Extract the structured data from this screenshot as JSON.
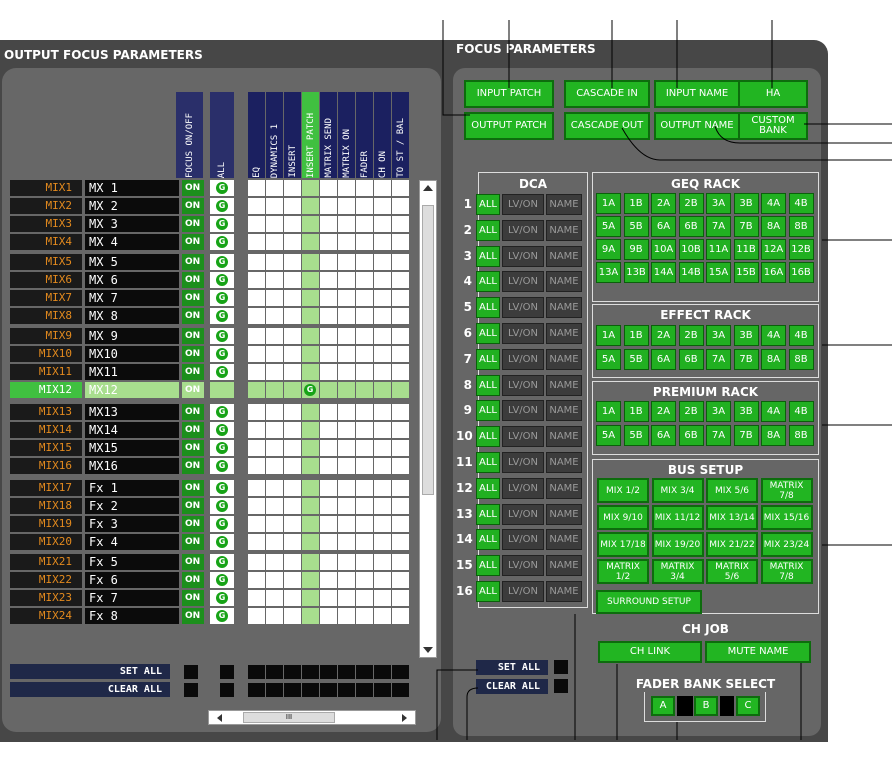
{
  "titles": {
    "output_focus": "OUTPUT FOCUS PARAMETERS",
    "focus": "FOCUS PARAMETERS"
  },
  "columns": [
    "FOCUS ON/OFF",
    "ALL",
    "EQ",
    "DYNAMICS 1",
    "INSERT",
    "INSERT PATCH",
    "MATRIX SEND",
    "MATRIX ON",
    "FADER",
    "CH ON",
    "TO ST / BAL"
  ],
  "rows": [
    {
      "mix": "MIX1",
      "name": "MX 1"
    },
    {
      "mix": "MIX2",
      "name": "MX 2"
    },
    {
      "mix": "MIX3",
      "name": "MX 3"
    },
    {
      "mix": "MIX4",
      "name": "MX 4"
    },
    {
      "mix": "MIX5",
      "name": "MX 5"
    },
    {
      "mix": "MIX6",
      "name": "MX 6"
    },
    {
      "mix": "MIX7",
      "name": "MX 7"
    },
    {
      "mix": "MIX8",
      "name": "MX 8"
    },
    {
      "mix": "MIX9",
      "name": "MX 9"
    },
    {
      "mix": "MIX10",
      "name": "MX10"
    },
    {
      "mix": "MIX11",
      "name": "MX11"
    },
    {
      "mix": "MIX12",
      "name": "MX12"
    },
    {
      "mix": "MIX13",
      "name": "MX13"
    },
    {
      "mix": "MIX14",
      "name": "MX14"
    },
    {
      "mix": "MIX15",
      "name": "MX15"
    },
    {
      "mix": "MIX16",
      "name": "MX16"
    },
    {
      "mix": "MIX17",
      "name": "Fx 1"
    },
    {
      "mix": "MIX18",
      "name": "Fx 2"
    },
    {
      "mix": "MIX19",
      "name": "Fx 3"
    },
    {
      "mix": "MIX20",
      "name": "Fx 4"
    },
    {
      "mix": "MIX21",
      "name": "Fx 5"
    },
    {
      "mix": "MIX22",
      "name": "Fx 6"
    },
    {
      "mix": "MIX23",
      "name": "Fx 7"
    },
    {
      "mix": "MIX24",
      "name": "Fx 8"
    }
  ],
  "on_label": "ON",
  "g_label": "G",
  "set_all": "SET ALL",
  "clear_all": "CLEAR ALL",
  "top_buttons": [
    "INPUT PATCH",
    "CASCADE IN",
    "INPUT NAME",
    "HA",
    "OUTPUT PATCH",
    "CASCADE OUT",
    "OUTPUT NAME",
    "CUSTOM BANK"
  ],
  "dca": {
    "title": "DCA",
    "numbers": [
      "1",
      "2",
      "3",
      "4",
      "5",
      "6",
      "7",
      "8",
      "9",
      "10",
      "11",
      "12",
      "13",
      "14",
      "15",
      "16"
    ],
    "all": "ALL",
    "lvon": "LV/ON",
    "name": "NAME"
  },
  "geq": {
    "title": "GEQ RACK",
    "buttons": [
      "1A",
      "1B",
      "2A",
      "2B",
      "3A",
      "3B",
      "4A",
      "4B",
      "5A",
      "5B",
      "6A",
      "6B",
      "7A",
      "7B",
      "8A",
      "8B",
      "9A",
      "9B",
      "10A",
      "10B",
      "11A",
      "11B",
      "12A",
      "12B",
      "13A",
      "13B",
      "14A",
      "14B",
      "15A",
      "15B",
      "16A",
      "16B"
    ]
  },
  "effect": {
    "title": "EFFECT RACK",
    "buttons": [
      "1A",
      "1B",
      "2A",
      "2B",
      "3A",
      "3B",
      "4A",
      "4B",
      "5A",
      "5B",
      "6A",
      "6B",
      "7A",
      "7B",
      "8A",
      "8B"
    ]
  },
  "premium": {
    "title": "PREMIUM RACK",
    "buttons": [
      "1A",
      "1B",
      "2A",
      "2B",
      "3A",
      "3B",
      "4A",
      "4B",
      "5A",
      "5B",
      "6A",
      "6B",
      "7A",
      "7B",
      "8A",
      "8B"
    ]
  },
  "bus": {
    "title": "BUS SETUP",
    "buttons": [
      "MIX 1/2",
      "MIX 3/4",
      "MIX 5/6",
      "MATRIX 7/8",
      "MIX 9/10",
      "MIX 11/12",
      "MIX 13/14",
      "MIX 15/16",
      "MIX 17/18",
      "MIX 19/20",
      "MIX 21/22",
      "MIX 23/24",
      "MATRIX 1/2",
      "MATRIX 3/4",
      "MATRIX 5/6",
      "MATRIX 7/8"
    ],
    "surround": "SURROUND SETUP"
  },
  "chjob": {
    "title": "CH JOB",
    "link": "CH LINK",
    "mute": "MUTE NAME"
  },
  "fader": {
    "title": "FADER BANK SELECT",
    "a": "A",
    "b": "B",
    "c": "C"
  },
  "scroll_thumb": "III",
  "colors": {
    "green": "#22b522",
    "orange": "#e38a1e",
    "panel": "#474747"
  }
}
